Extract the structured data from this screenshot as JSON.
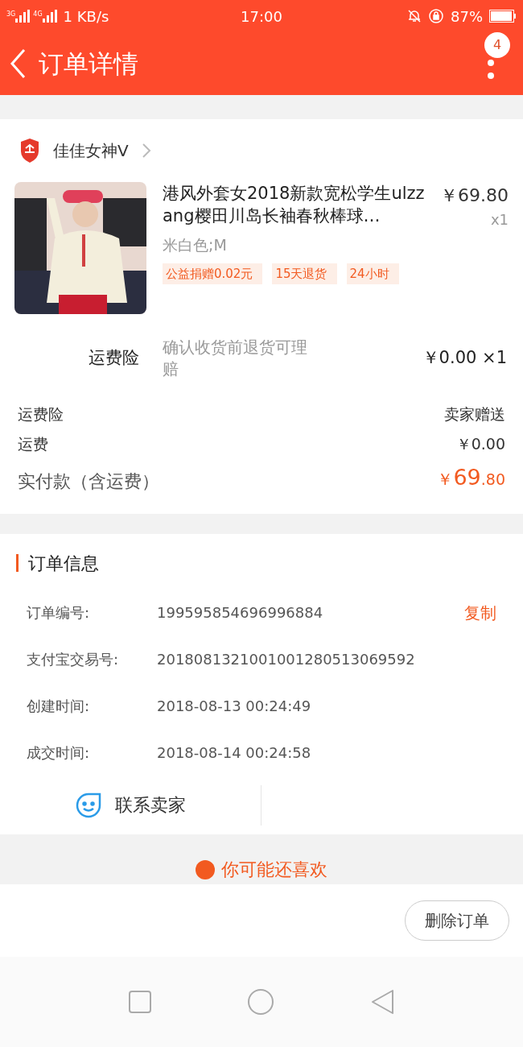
{
  "status_bar": {
    "network_speed": "1 KB/s",
    "time": "17:00",
    "battery": "87%",
    "signal_labels": [
      "3G",
      "4G"
    ]
  },
  "header": {
    "title": "订单详情",
    "badge": "4"
  },
  "shop": {
    "name": "佳佳女神V"
  },
  "product": {
    "title": "港风外套女2018新款宽松学生ulzzang樱田川岛长袖春秋棒球…",
    "price": "￥69.80",
    "quantity": "x1",
    "variant": "米白色;M",
    "tags": [
      "公益捐赠0.02元",
      "15天退货",
      "24小时"
    ]
  },
  "insurance": {
    "label": "运费险",
    "description": "确认收货前退货可理赔",
    "price": "￥0.00 ×1"
  },
  "summary": [
    {
      "label": "运费险",
      "value": "卖家赠送"
    },
    {
      "label": "运费",
      "value": "￥0.00"
    }
  ],
  "total": {
    "label": "实付款（含运费）",
    "currency": "￥",
    "integer": "69",
    "decimal": ".80"
  },
  "order_info": {
    "title": "订单信息",
    "rows": [
      {
        "label": "订单编号:",
        "value": "199595854696996884",
        "action": "复制"
      },
      {
        "label": "支付宝交易号:",
        "value": "2018081321001001280513069592"
      },
      {
        "label": "创建时间:",
        "value": "2018-08-13 00:24:49"
      },
      {
        "label": "成交时间:",
        "value": "2018-08-14 00:24:58"
      }
    ],
    "contact": "联系卖家"
  },
  "recommend": {
    "title": "你可能还喜欢"
  },
  "footer": {
    "button": "删除订单"
  }
}
